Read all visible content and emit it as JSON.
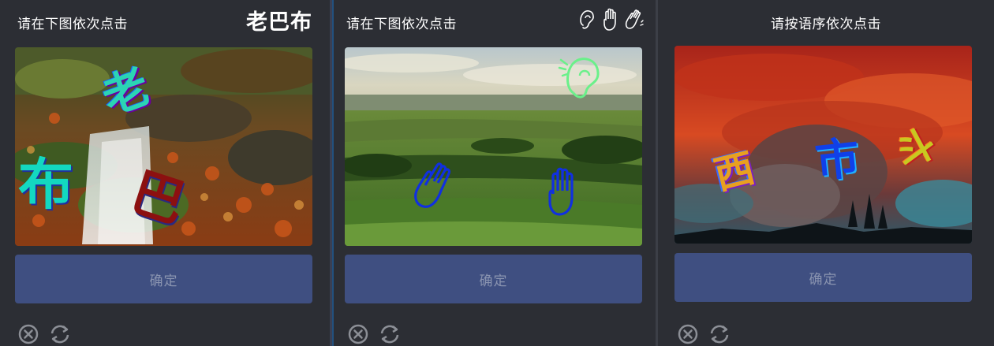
{
  "panels": [
    {
      "title": "请在下图依次点击",
      "hint_text": "老巴布",
      "image_chars": [
        "老",
        "布",
        "巴"
      ],
      "confirm_label": "确定",
      "icons": [
        "close-circle-icon",
        "refresh-icon"
      ]
    },
    {
      "title": "请在下图依次点击",
      "hint_icons": [
        "ear-icon",
        "hand-icon",
        "waving-hand-icon"
      ],
      "confirm_label": "确定",
      "icons": [
        "close-circle-icon",
        "refresh-icon"
      ]
    },
    {
      "title": "请按语序依次点击",
      "image_chars": [
        "西",
        "市",
        "斗"
      ],
      "confirm_label": "确定",
      "icons": [
        "close-circle-icon",
        "refresh-icon"
      ]
    }
  ],
  "colors": {
    "background": "#2c2e34",
    "button": "#3f4f81",
    "button_text": "#8a94b0",
    "icon": "#8c8f96"
  }
}
